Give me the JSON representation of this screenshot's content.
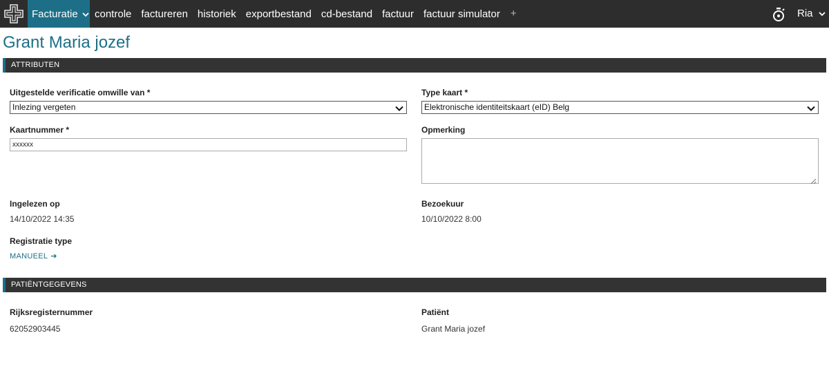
{
  "nav": {
    "app_menu": "Facturatie",
    "items": [
      "controle",
      "factureren",
      "historiek",
      "exportbestand",
      "cd-bestand",
      "factuur",
      "factuur simulator"
    ],
    "add": "+",
    "user": "Ria"
  },
  "page": {
    "title": "Grant Maria jozef"
  },
  "attributen": {
    "header": "ATTRIBUTEN",
    "reason_label": "Uitgestelde verificatie omwille van *",
    "reason_value": "Inlezing vergeten",
    "card_type_label": "Type kaart *",
    "card_type_value": "Elektronische identiteitskaart (eID) Belg",
    "card_number_label": "Kaartnummer *",
    "card_number_value": "xxxxxx",
    "remark_label": "Opmerking",
    "remark_value": "",
    "read_on_label": "Ingelezen op",
    "read_on_value": "14/10/2022 14:35",
    "visit_time_label": "Bezoekuur",
    "visit_time_value": "10/10/2022 8:00",
    "reg_type_label": "Registratie type",
    "reg_type_value": "MANUEEL",
    "reg_type_arrow": "➔"
  },
  "patient": {
    "header": "PATIËNTGEGEVENS",
    "rrn_label": "Rijksregisternummer",
    "rrn_value": "62052903445",
    "patient_label": "Patiënt",
    "patient_value": "Grant Maria jozef"
  },
  "icons": {
    "logo": "cross-logo-icon",
    "app_menu_chevron": "chevron-down-icon",
    "timer": "stopwatch-icon",
    "user_chevron": "chevron-down-icon",
    "select_chevron": "chevron-down-icon",
    "resize": "resize-grip-icon"
  },
  "colors": {
    "accent": "#1d6f87",
    "topbar": "#2d2d2d",
    "section_bar": "#333333"
  }
}
